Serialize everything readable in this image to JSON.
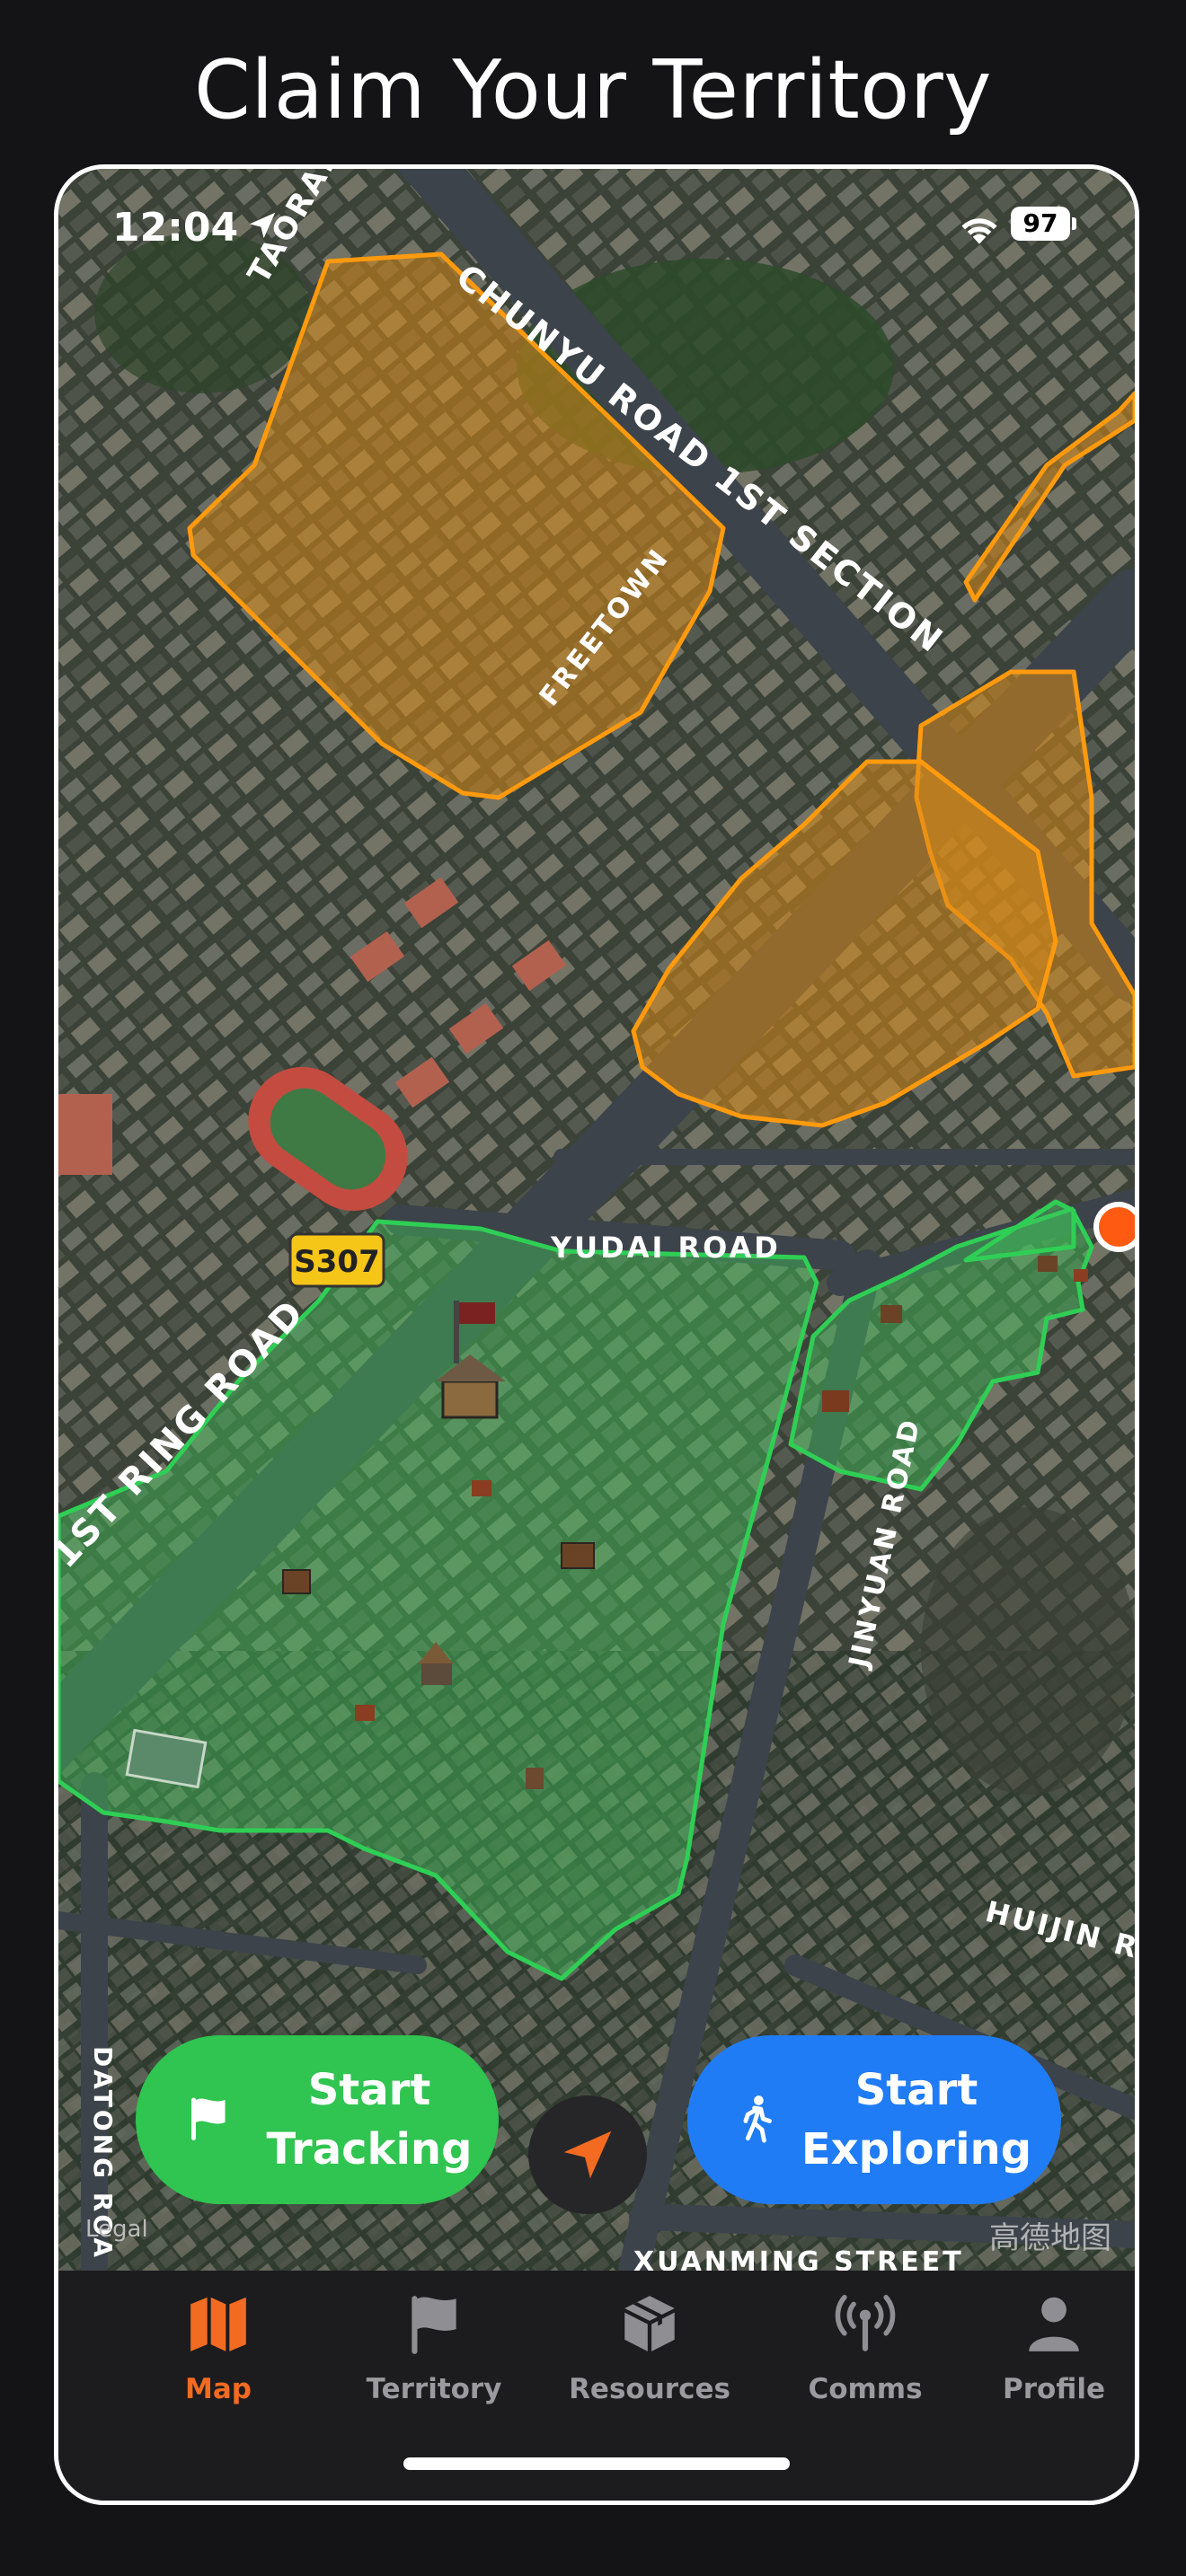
{
  "headline": "Claim Your Territory",
  "status_bar": {
    "time": "12:04",
    "battery": "97"
  },
  "map": {
    "road_labels": {
      "taoran": "TAORAN",
      "chunyu": "CHUNYU ROAD 1ST SECTION",
      "freetown": "FREETOWN",
      "s307": "S307",
      "yudai": "YUDAI ROAD",
      "ring": "1ST RING ROAD",
      "jinyuan": "JINYUAN ROAD",
      "huijin": "HUIJIN RO",
      "datong": "DATONG ROA",
      "xuanming": "XUANMING STREET"
    },
    "attribution": "Legal",
    "watermark": "高德地图",
    "territory_colors": {
      "claimed": "#34c759",
      "other": "#ff9500"
    }
  },
  "actions": {
    "start_tracking": {
      "line1": "Start",
      "line2": "Tracking",
      "icon": "flag-icon",
      "color": "#30c450"
    },
    "locate": {
      "icon": "location-arrow-icon"
    },
    "start_exploring": {
      "line1": "Start",
      "line2": "Exploring",
      "icon": "walking-person-icon",
      "color": "#1f7cf5"
    }
  },
  "tabs": [
    {
      "label": "Map",
      "icon": "map-icon",
      "active": true
    },
    {
      "label": "Territory",
      "icon": "flag-icon",
      "active": false
    },
    {
      "label": "Resources",
      "icon": "box-icon",
      "active": false
    },
    {
      "label": "Comms",
      "icon": "antenna-icon",
      "active": false
    },
    {
      "label": "Profile",
      "icon": "person-icon",
      "active": false
    }
  ],
  "accent_color": "#f26b21"
}
